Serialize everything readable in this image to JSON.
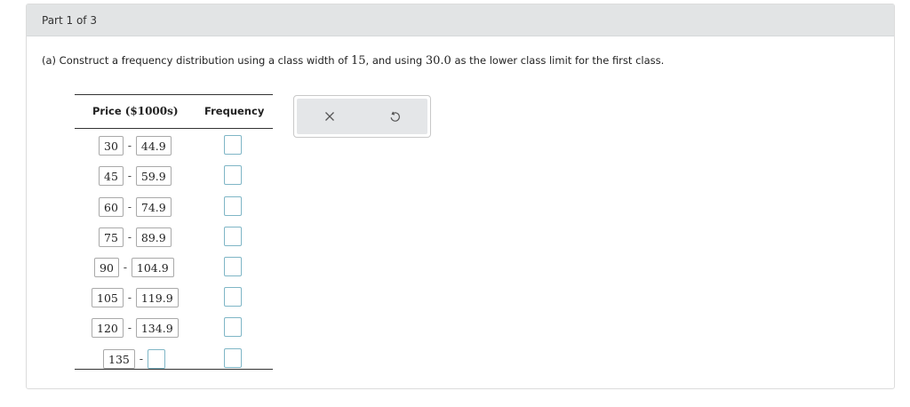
{
  "header": {
    "title": "Part 1 of 3"
  },
  "question": {
    "prefix": "(a) Construct a frequency distribution using a class width of",
    "width": "15",
    "middle": ", and using",
    "lower": "30.0",
    "suffix": "as the lower class limit for the first class."
  },
  "table": {
    "col_price_label": "Price",
    "col_price_unit": "($1000s)",
    "col_freq_label": "Frequency",
    "rows": [
      {
        "lower": "30",
        "upper": "44.9"
      },
      {
        "lower": "45",
        "upper": "59.9"
      },
      {
        "lower": "60",
        "upper": "74.9"
      },
      {
        "lower": "75",
        "upper": "89.9"
      },
      {
        "lower": "90",
        "upper": "104.9"
      },
      {
        "lower": "105",
        "upper": "119.9"
      },
      {
        "lower": "120",
        "upper": "134.9"
      },
      {
        "lower": "135",
        "upper": ""
      }
    ],
    "dash": "-"
  },
  "toolbar": {
    "clear_icon": "close-icon",
    "reset_icon": "undo-icon"
  },
  "colors": {
    "input_border": "#7fb6c6",
    "header_bg": "#e2e4e5"
  }
}
